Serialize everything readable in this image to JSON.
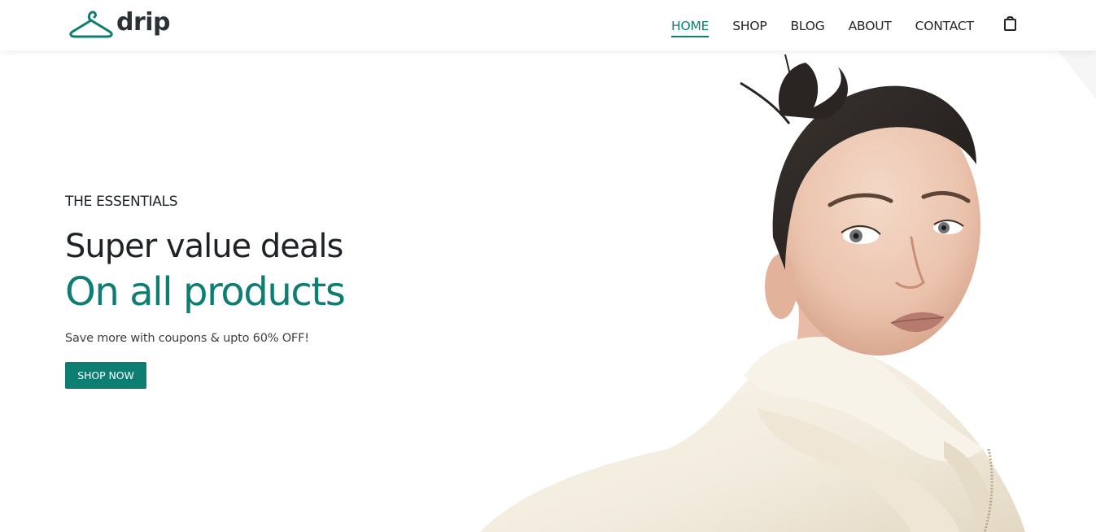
{
  "brand": {
    "name": "drip",
    "accent_color": "#0e7d72",
    "text_color": "#2a3238"
  },
  "nav": {
    "items": [
      {
        "label": "HOME",
        "active": true
      },
      {
        "label": "SHOP",
        "active": false
      },
      {
        "label": "BLOG",
        "active": false
      },
      {
        "label": "ABOUT",
        "active": false
      },
      {
        "label": "CONTACT",
        "active": false
      }
    ],
    "cart_icon": "shopping-bag-icon"
  },
  "hero": {
    "eyebrow": "THE ESSENTIALS",
    "headline_line1": "Super value deals",
    "headline_line2": "On all products",
    "subtext": "Save more with coupons & upto 60% OFF!",
    "cta_label": "SHOP NOW",
    "image": "model-in-white-puffer-jacket"
  }
}
